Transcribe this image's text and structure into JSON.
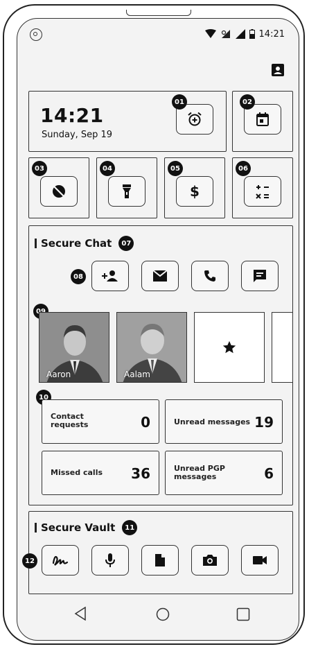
{
  "status_bar": {
    "time": "14:21"
  },
  "clock_widget": {
    "time": "14:21",
    "date": "Sunday, Sep 19",
    "badge": "01"
  },
  "calendar_widget": {
    "badge": "02"
  },
  "quick_actions": [
    {
      "badge": "03",
      "icon": "disabled-eye-icon"
    },
    {
      "badge": "04",
      "icon": "flashlight-icon"
    },
    {
      "badge": "05",
      "icon": "dollar-icon"
    },
    {
      "badge": "06",
      "icon": "calculator-icon"
    }
  ],
  "secure_chat": {
    "title": "Secure Chat",
    "title_badge": "07",
    "actions_badge": "08",
    "contacts_badge": "09",
    "contacts": [
      {
        "name": "Aaron"
      },
      {
        "name": "Aalam"
      }
    ],
    "stats_badge": "10",
    "stats": {
      "contact_requests": {
        "label": "Contact requests",
        "value": "0"
      },
      "unread_messages": {
        "label": "Unread messages",
        "value": "19"
      },
      "missed_calls": {
        "label": "Missed calls",
        "value": "36"
      },
      "unread_pgp": {
        "label": "Unread PGP messages",
        "value": "6"
      }
    }
  },
  "secure_vault": {
    "title": "Secure Vault",
    "title_badge": "11",
    "actions_badge": "12"
  }
}
